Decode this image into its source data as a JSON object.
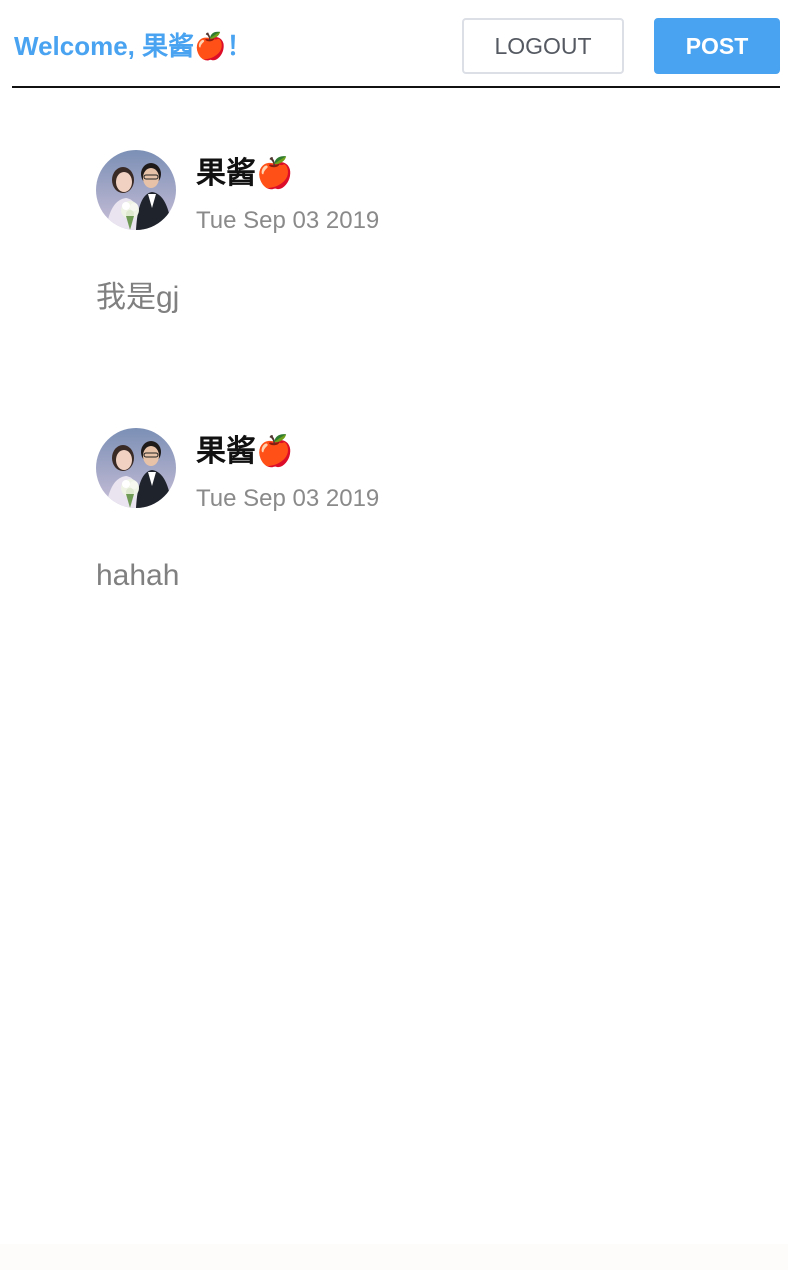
{
  "header": {
    "welcome_text": "Welcome, 果酱🍎！",
    "logout_label": "LOGOUT",
    "post_label": "POST"
  },
  "colors": {
    "accent": "#4aa3f0",
    "divider": "#111111",
    "muted_text": "#808080"
  },
  "posts": [
    {
      "author": "果酱🍎",
      "date": "Tue Sep 03 2019",
      "content": "我是gj",
      "avatar_icon": "avatar-photo-couple"
    },
    {
      "author": "果酱🍎",
      "date": "Tue Sep 03 2019",
      "content": "hahah",
      "avatar_icon": "avatar-photo-couple"
    }
  ]
}
